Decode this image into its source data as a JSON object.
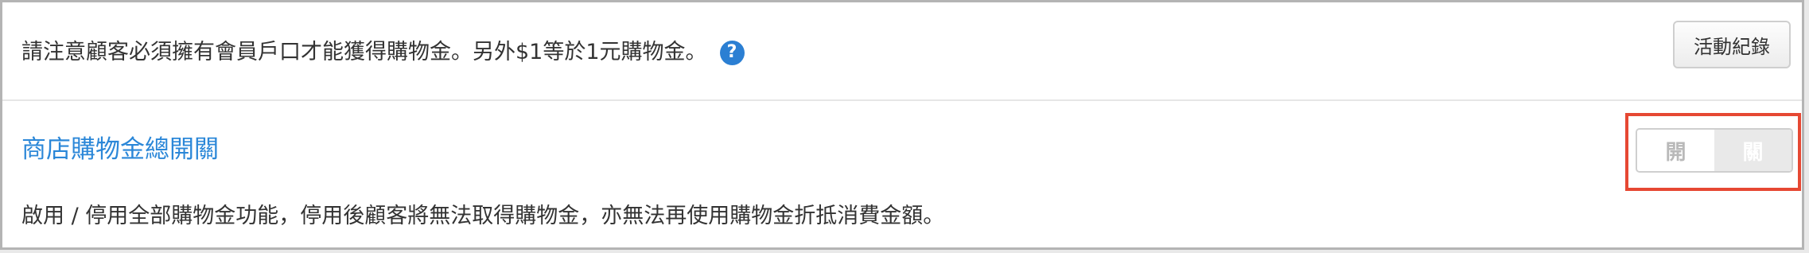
{
  "notice": {
    "text": "請注意顧客必須擁有會員戶口才能獲得購物金。另外$1等於1元購物金。",
    "help_icon": "question-circle-icon",
    "help_glyph": "?"
  },
  "toolbar": {
    "activity_log_label": "活動紀錄"
  },
  "setting": {
    "title": "商店購物金總開關",
    "description": "啟用 / 停用全部購物金功能，停用後顧客將無法取得購物金，亦無法再使用購物金折抵消費金額。",
    "toggle": {
      "on_label": "開",
      "off_label": "關",
      "state": "off"
    }
  },
  "colors": {
    "link_blue": "#2b87d8",
    "help_icon_blue": "#2b7fd3",
    "highlight_red": "#e64833"
  }
}
